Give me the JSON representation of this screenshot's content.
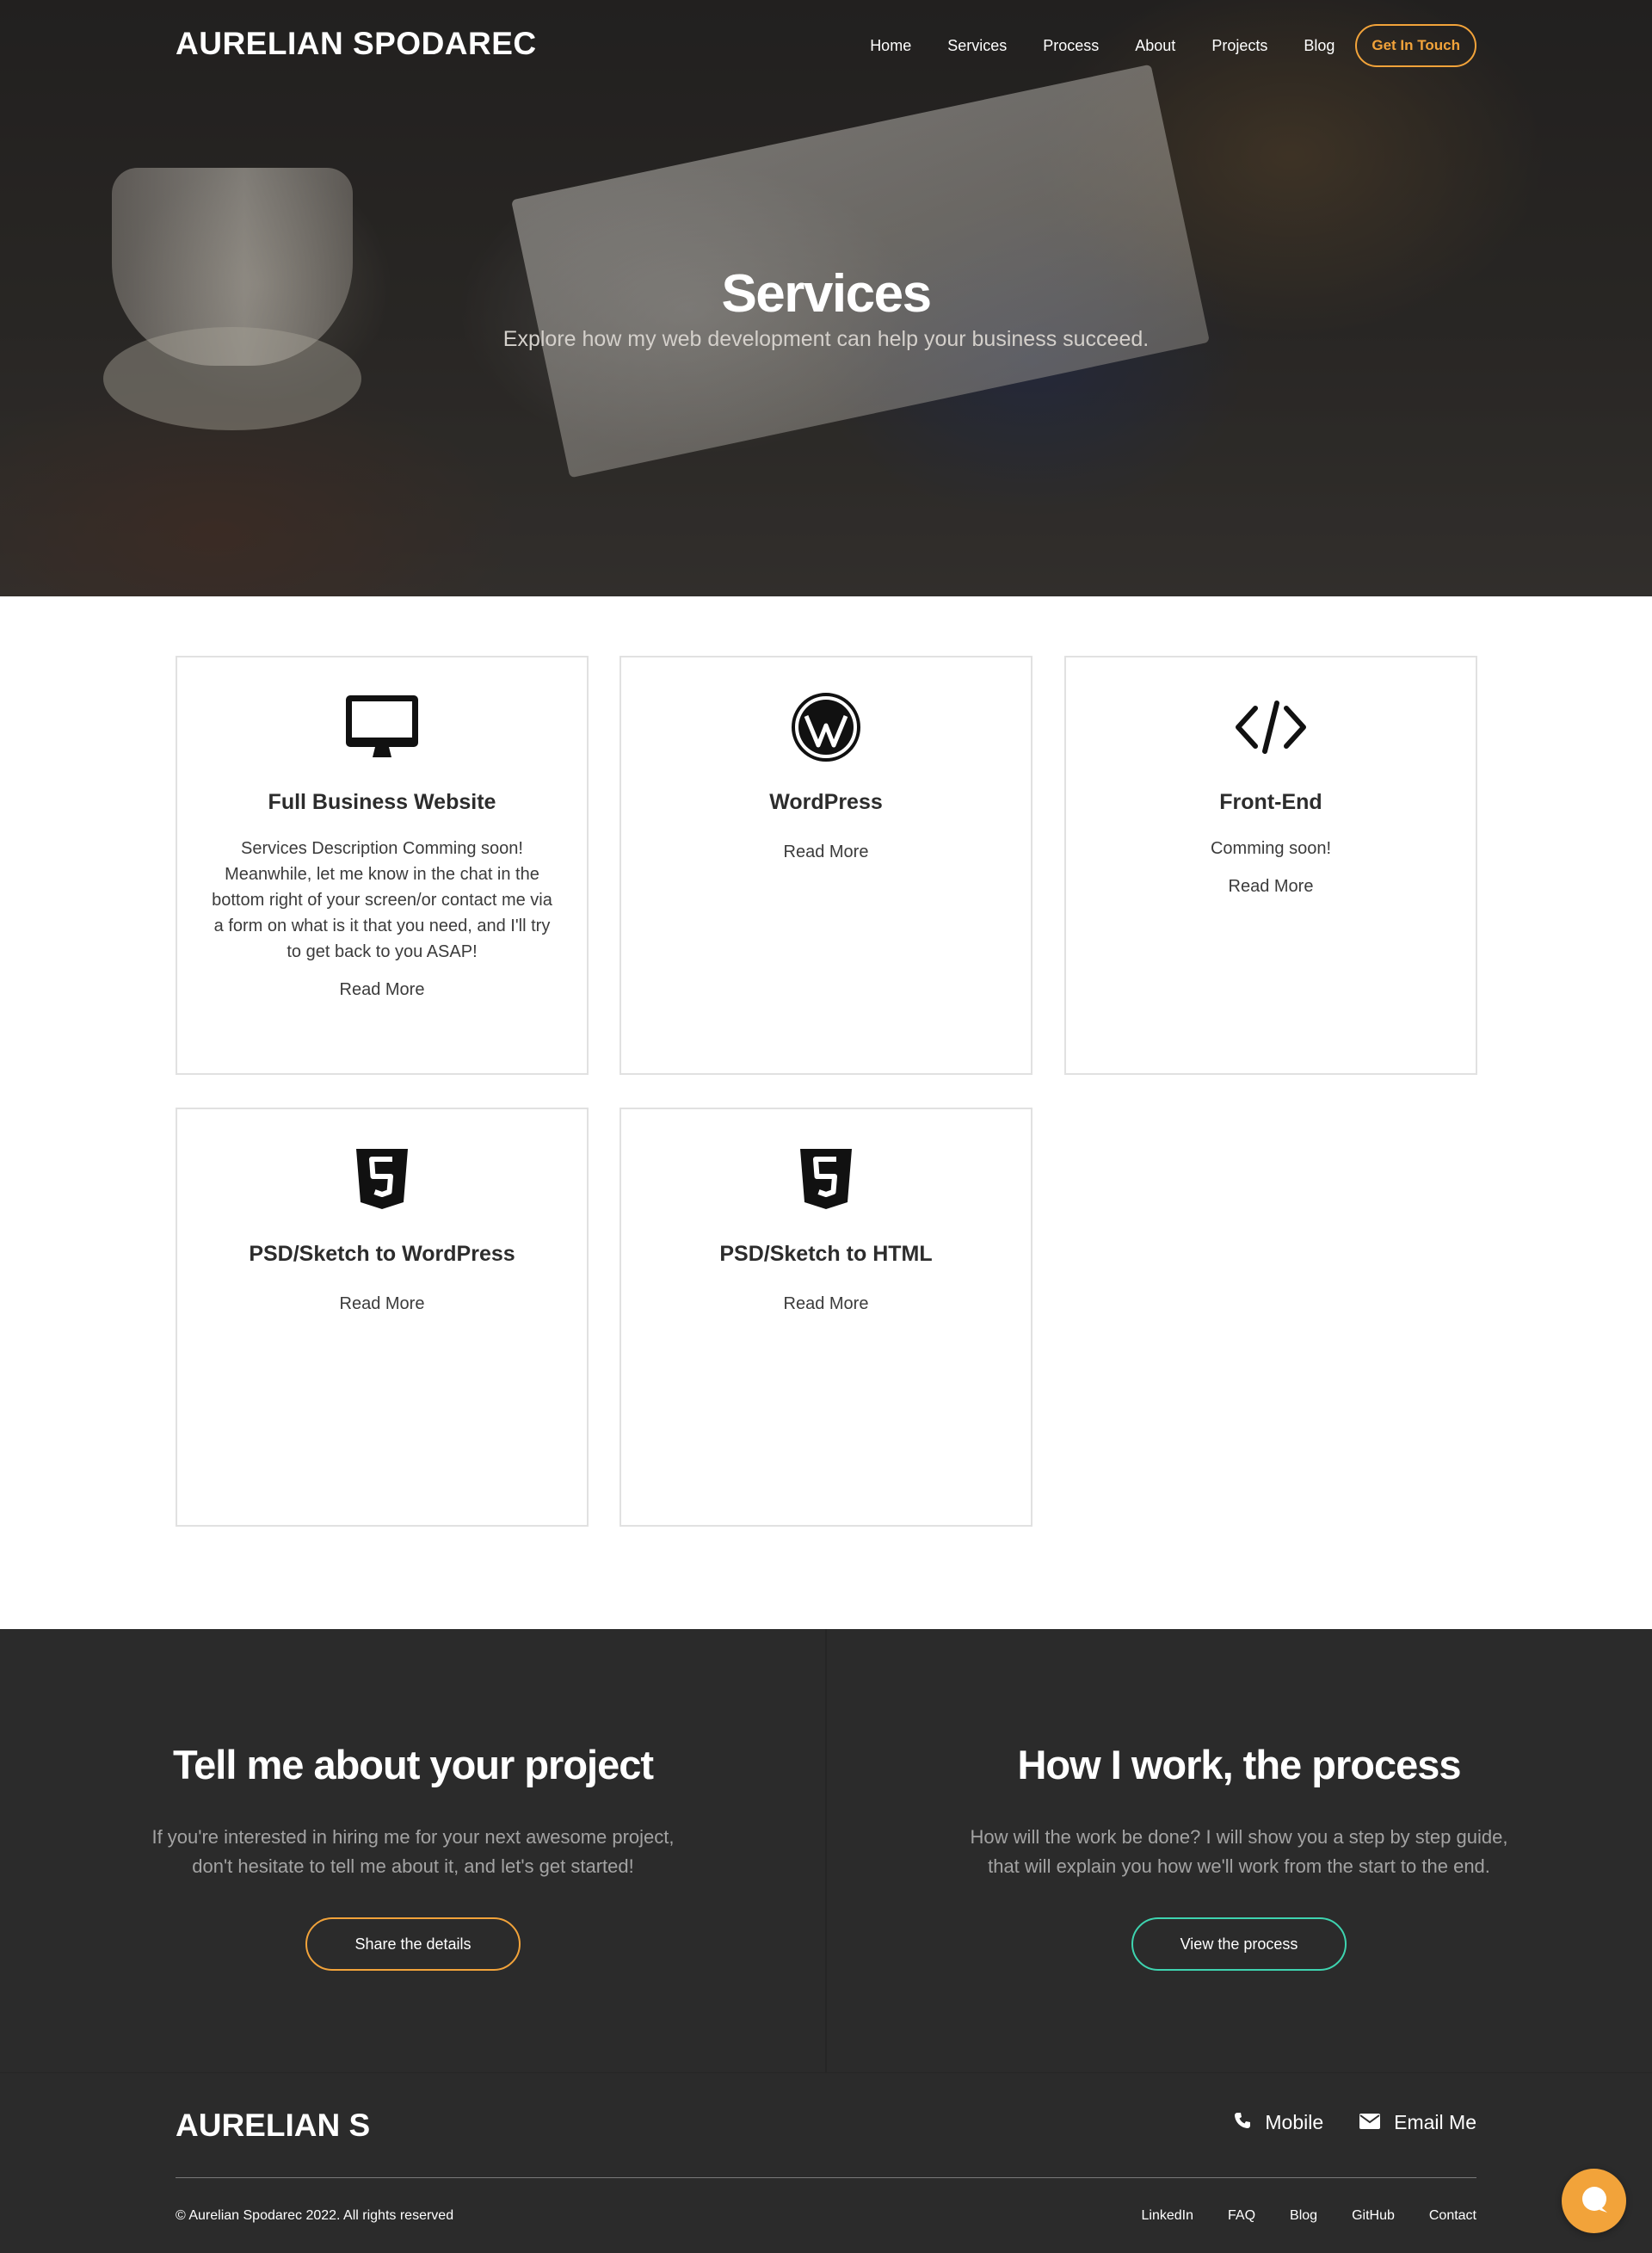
{
  "header": {
    "brand": "AURELIAN SPODAREC",
    "nav": [
      "Home",
      "Services",
      "Process",
      "About",
      "Projects",
      "Blog"
    ],
    "cta": "Get In Touch"
  },
  "hero": {
    "title": "Services",
    "subtitle": "Explore how my web development can help your business succeed."
  },
  "services": [
    {
      "icon": "desktop-icon",
      "title": "Full Business Website",
      "description": "Services Description Comming soon! Meanwhile, let me know in the chat in the bottom right of your screen/or contact me via a form on what is it that you need, and I'll try to get back to you ASAP!",
      "link": "Read More"
    },
    {
      "icon": "wordpress-icon",
      "title": "WordPress",
      "description": "",
      "link": "Read More"
    },
    {
      "icon": "code-icon",
      "title": "Front-End",
      "description": "Comming soon!",
      "link": "Read More"
    },
    {
      "icon": "html5-icon",
      "title": "PSD/Sketch to WordPress",
      "description": "",
      "link": "Read More"
    },
    {
      "icon": "html5-icon",
      "title": "PSD/Sketch to HTML",
      "description": "",
      "link": "Read More"
    }
  ],
  "cta": {
    "left": {
      "title": "Tell me about your project",
      "text": "If you're interested in hiring me for your next awesome project, don't hesitate to tell me about it, and let's get started!",
      "button": "Share the details"
    },
    "right": {
      "title": "How I work, the process",
      "text": "How will the work be done? I will show you a step by step guide, that will explain you how we'll work from the start to the end.",
      "button": "View the process"
    }
  },
  "footer": {
    "brand": "AURELIAN S",
    "mobile": "Mobile",
    "email": "Email Me",
    "copyright": "© Aurelian Spodarec 2022. All rights reserved",
    "links": [
      "LinkedIn",
      "FAQ",
      "Blog",
      "GitHub",
      "Contact"
    ]
  },
  "colors": {
    "accent_orange": "#f2a33a",
    "accent_teal": "#3ed4b0",
    "dark_bg": "#2b2b2b"
  },
  "chat": {
    "icon": "chat-bubble-icon"
  }
}
